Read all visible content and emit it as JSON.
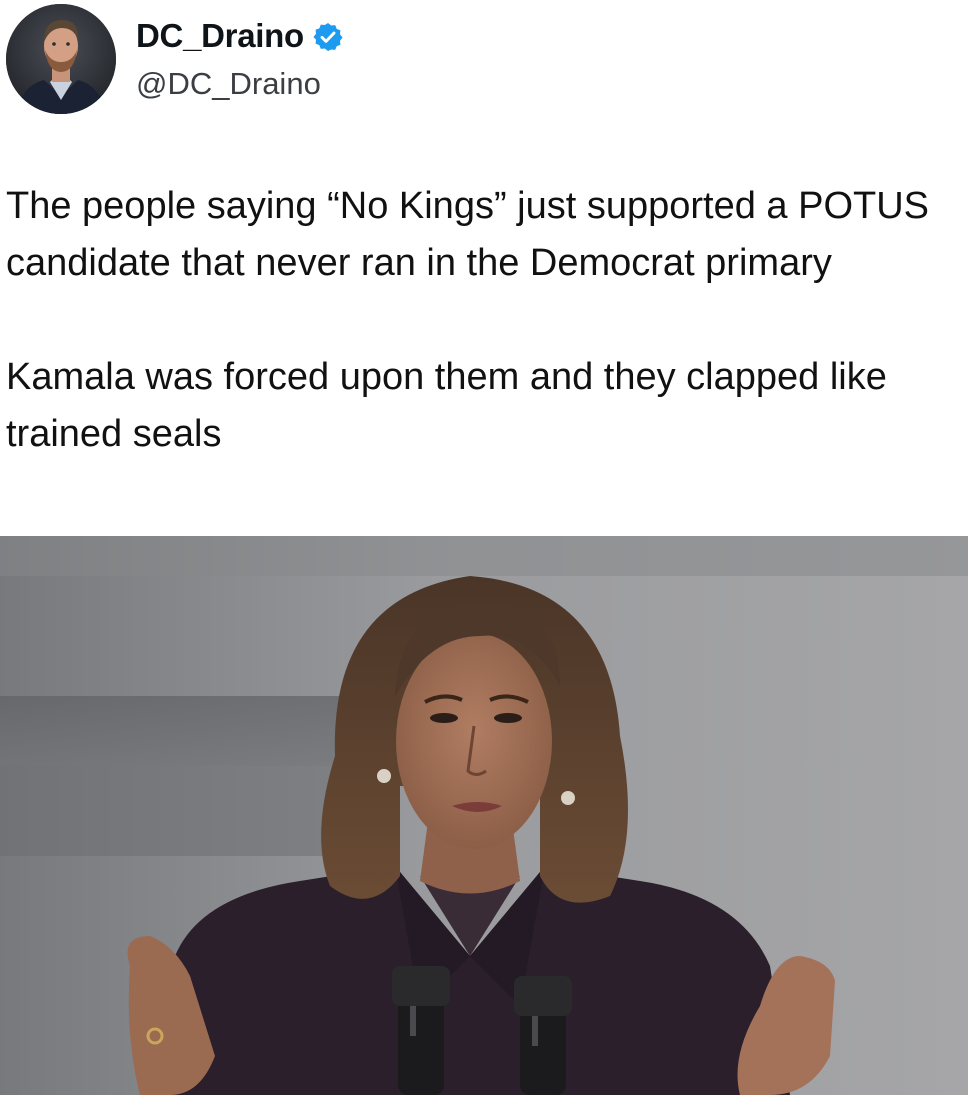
{
  "author": {
    "display_name": "DC_Draino",
    "handle": "@DC_Draino",
    "verified": true,
    "verified_badge_color": "#1d9bf0",
    "avatar_icon": "profile-photo-man-beard"
  },
  "tweet": {
    "paragraphs": [
      "The people saying “No Kings” just supported a POTUS candidate that never ran in the Democrat primary",
      "Kamala was forced upon them and they clapped like trained seals"
    ]
  },
  "media": {
    "description_icon": "photo-woman-speaking-at-podium"
  }
}
